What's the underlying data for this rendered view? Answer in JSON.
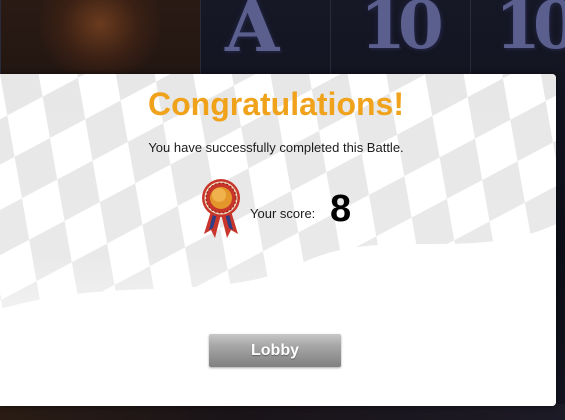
{
  "background": {
    "symbols": [
      "A",
      "10",
      "10"
    ]
  },
  "dialog": {
    "title": "Congratulations!",
    "message": "You have successfully completed this Battle.",
    "score_label": "Your score:",
    "score_value": "8",
    "lobby_button_label": "Lobby",
    "medal_icon": "medal-icon"
  },
  "colors": {
    "title": "#f0a21b",
    "button_top": "#c7c7c7",
    "button_bottom": "#7f7f7f",
    "medal_gold": "#e3962a",
    "medal_ribbon_red": "#c8352b",
    "medal_ribbon_blue": "#2f3f86"
  }
}
